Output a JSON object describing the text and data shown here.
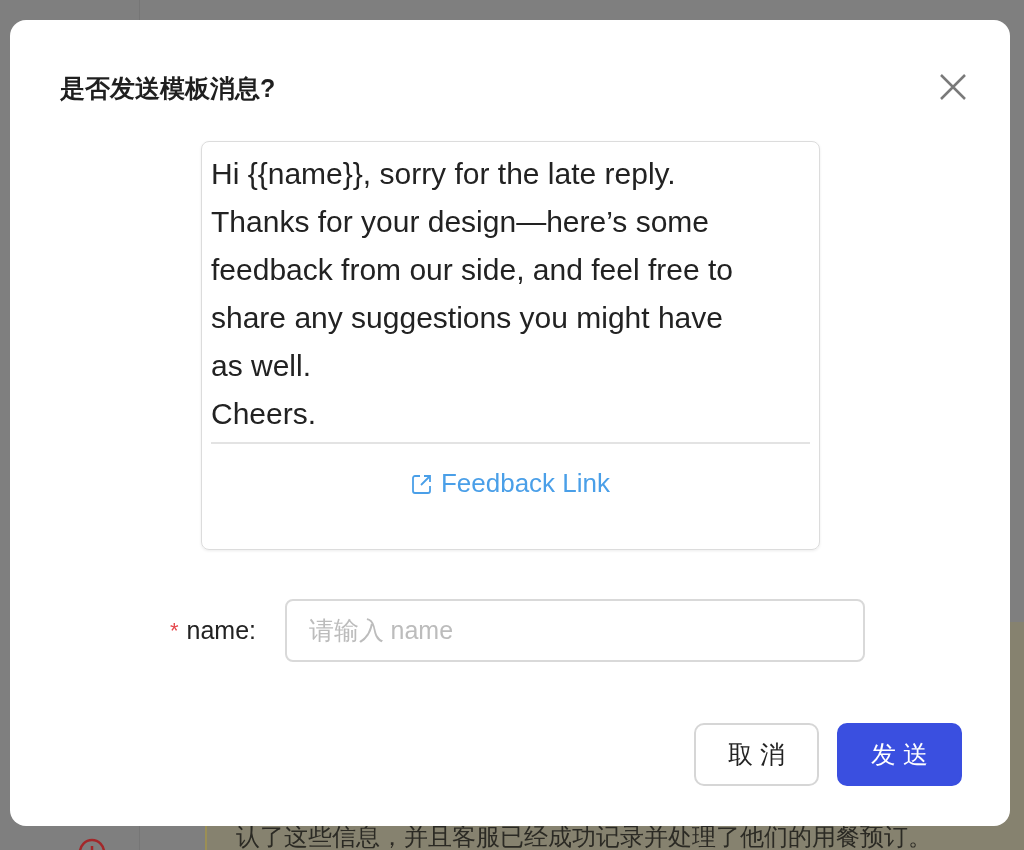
{
  "background": {
    "note": "认了这些信息，并且客服已经成功记录并处理了他们的用餐预订。"
  },
  "dialog": {
    "title": "是否发送模板消息?",
    "message": "Hi {{name}}, sorry for the late reply.\nThanks for your design—here’s some\nfeedback from our side, and feel free to\nshare any suggestions you might have\nas well.\nCheers.",
    "link": "Feedback Link",
    "field": {
      "required_mark": "*",
      "label": "name",
      "separator": ":",
      "placeholder": "请输入 name"
    },
    "buttons": [
      {
        "label": "取 消",
        "kind": "secondary"
      },
      {
        "label": "发 送",
        "kind": "primary"
      }
    ]
  }
}
